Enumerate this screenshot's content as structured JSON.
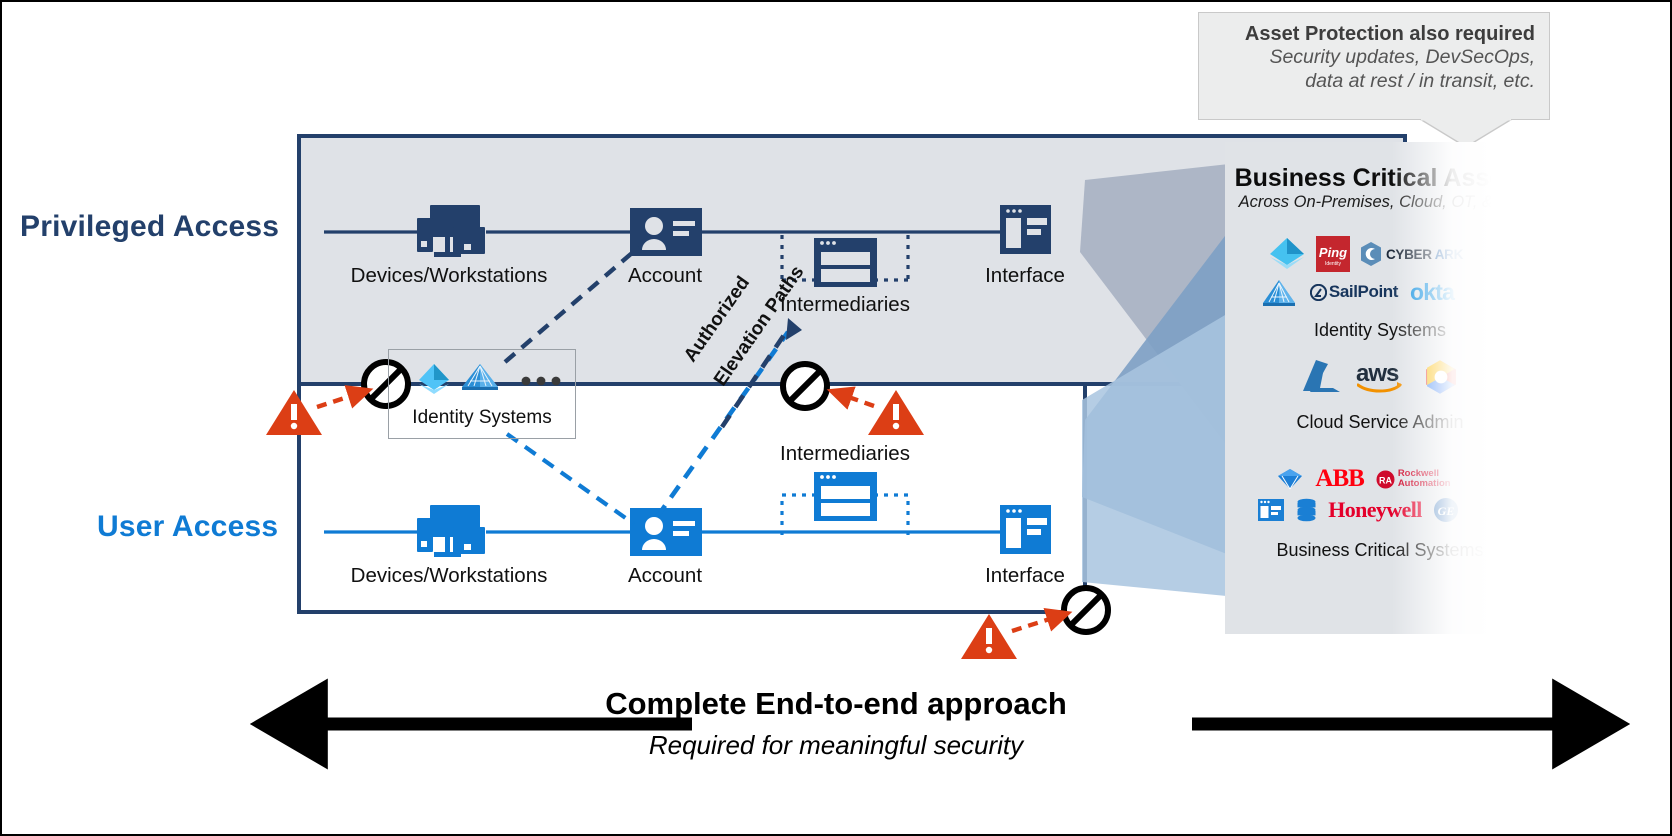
{
  "callout": {
    "title": "Asset Protection also required",
    "line1": "Security updates, DevSecOps,",
    "line2": "data at rest / in transit, etc."
  },
  "rows": {
    "privileged": {
      "label": "Privileged Access",
      "color": "#23406b",
      "nodes": [
        {
          "name": "devices",
          "label": "Devices/Workstations"
        },
        {
          "name": "account",
          "label": "Account"
        },
        {
          "name": "intermediaries",
          "label": "Intermediaries"
        },
        {
          "name": "interface",
          "label": "Interface"
        }
      ],
      "identity_systems_label": "Identity Systems"
    },
    "user": {
      "label": "User Access",
      "color": "#0f7bd4",
      "nodes": [
        {
          "name": "devices",
          "label": "Devices/Workstations"
        },
        {
          "name": "account",
          "label": "Account"
        },
        {
          "name": "intermediaries",
          "label": "Intermediaries"
        },
        {
          "name": "interface",
          "label": "Interface"
        }
      ]
    }
  },
  "elevation": {
    "line1": "Authorized",
    "line2": "Elevation Paths"
  },
  "assets": {
    "title": "Business Critical Assets",
    "subtitle": "Across On-Premises, Cloud, OT, & IoT",
    "dots": "•••",
    "groups": [
      {
        "name": "identity-systems",
        "caption": "Identity Systems",
        "logos_row1": [
          "azure-ad-icon",
          "ping-identity-logo",
          "cyberark-logo"
        ],
        "logos_row2": [
          "adfs-pyramid-icon",
          "sailpoint-logo",
          "okta-logo"
        ],
        "labels": {
          "ping": "Ping",
          "ping_sub": "Identity",
          "cyberark_a": "CYBER",
          "cyberark_b": "ARK",
          "sailpoint": "SailPoint",
          "okta": "okta"
        }
      },
      {
        "name": "cloud-service-admin",
        "caption": "Cloud Service Admin",
        "logos_row1": [
          "azure-logo",
          "aws-logo",
          "google-cloud-logo"
        ],
        "labels": {
          "aws": "aws"
        }
      },
      {
        "name": "business-critical-systems",
        "caption": "Business Critical Systems",
        "logos_row1": [
          "sap-diamond-logo",
          "abb-logo",
          "rockwell-automation-logo"
        ],
        "logos_row2": [
          "app-window-icon",
          "database-icon",
          "honeywell-logo",
          "ge-logo"
        ],
        "labels": {
          "abb": "ABB",
          "rockwell_a": "Rockwell",
          "rockwell_b": "Automation",
          "rockwell_mark": "RA",
          "honeywell": "Honeywell",
          "ge": "GE"
        }
      }
    ]
  },
  "bottom": {
    "title": "Complete End-to-end approach",
    "subtitle": "Required for meaningful security"
  },
  "colors": {
    "navy": "#23406b",
    "blue": "#0f7bd4",
    "red": "#dc3e15",
    "panel_grey": "#e0e3e7",
    "priv_fill": "#dfe2e7"
  }
}
